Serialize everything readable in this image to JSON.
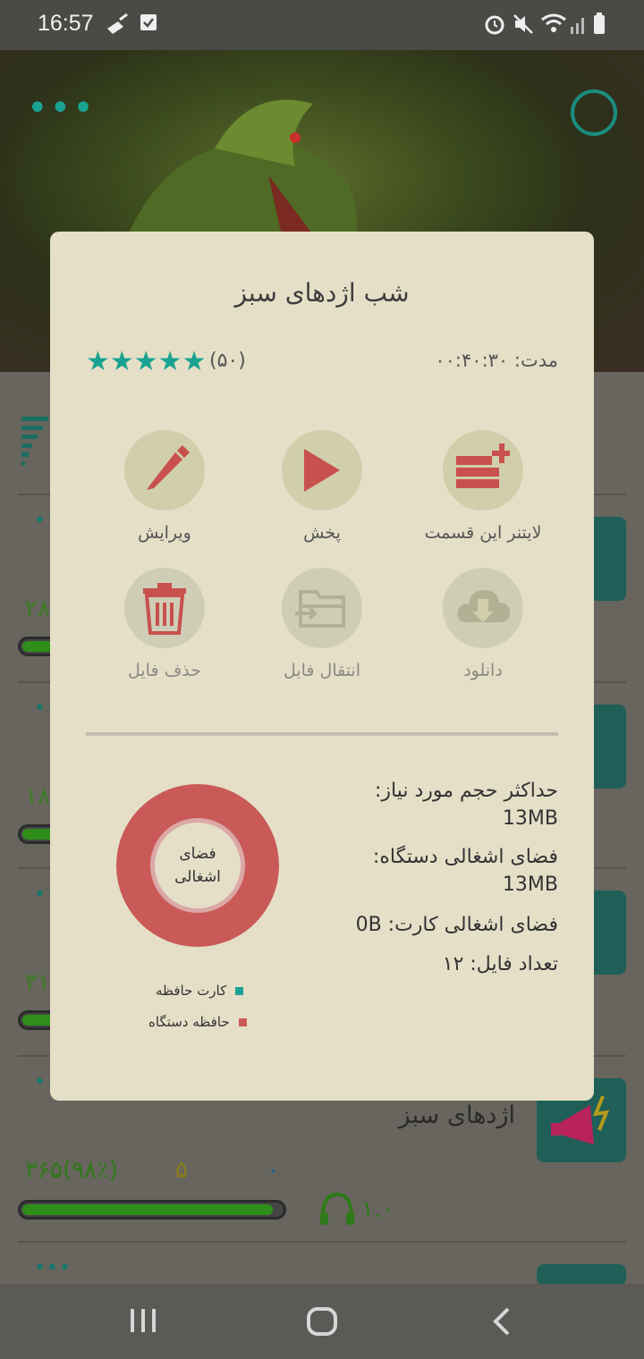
{
  "status": {
    "time": "16:57"
  },
  "dialog": {
    "title": "شب اژدهای سبز",
    "duration_label": "مدت: ۰۰:۴۰:۳۰",
    "stars": "★★★★★",
    "votes": "(۵۰)",
    "actions": [
      {
        "label": "لایتنر این قسمت",
        "icon": "add-to-list-icon"
      },
      {
        "label": "پخش",
        "icon": "play-icon"
      },
      {
        "label": "ویرایش",
        "icon": "edit-pencil-icon"
      },
      {
        "label": "دانلود",
        "icon": "cloud-download-icon"
      },
      {
        "label": "انتقال فایل",
        "icon": "folder-move-icon"
      },
      {
        "label": "حذف فایل",
        "icon": "trash-icon"
      }
    ],
    "max_size_label": "حداکثر حجم مورد نیاز:",
    "max_size_value": "13MB",
    "device_used_label": "فضای اشغالی دستگاه:",
    "device_used_value": "13MB",
    "card_used": "فضای اشغالی کارت: 0B",
    "file_count": "تعداد فایل: ۱۲",
    "donut_center": "فضای اشغالی",
    "legend_card": "کارت حافظه",
    "legend_device": "حافظه دستگاه",
    "colors": {
      "card": "#1aa392",
      "device": "#c95a57"
    }
  },
  "list": {
    "rows": [
      {
        "partial_number": "۲۸"
      },
      {
        "partial_number": "۱۸"
      },
      {
        "partial_number": "۳۱"
      },
      {
        "title": "اژدهای سبز",
        "stats": "۳۶۵(۹۸٪)",
        "count": "۵",
        "zero": "۰",
        "listen": "۱.۰"
      }
    ]
  }
}
